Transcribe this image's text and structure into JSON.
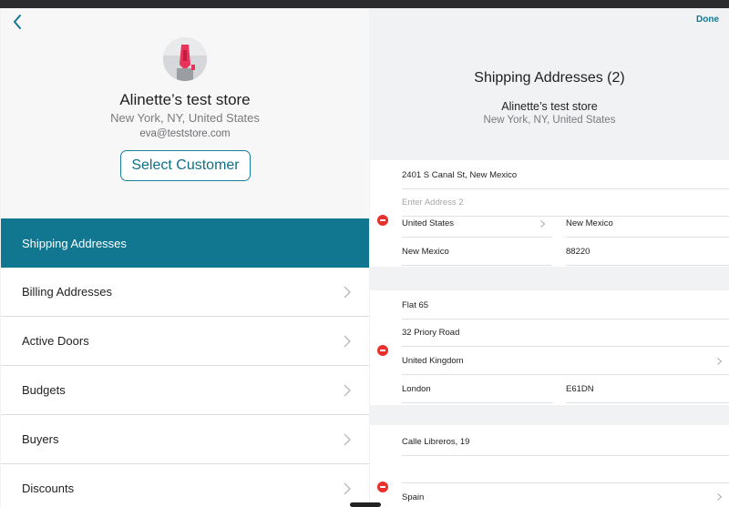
{
  "left": {
    "back_icon": "chevron-left-icon",
    "store_name": "Alinette’s test store",
    "store_location": "New York, NY, United States",
    "store_email": "eva@teststore.com",
    "select_customer_label": "Select Customer",
    "menu": [
      {
        "label": "Shipping Addresses",
        "active": true
      },
      {
        "label": "Billing Addresses",
        "active": false
      },
      {
        "label": "Active Doors",
        "active": false
      },
      {
        "label": "Budgets",
        "active": false
      },
      {
        "label": "Buyers",
        "active": false
      },
      {
        "label": "Discounts",
        "active": false
      }
    ]
  },
  "right": {
    "done_label": "Done",
    "title": "Shipping Addresses (2)",
    "store_name": "Alinette’s test store",
    "store_location": "New York, NY, United States",
    "addresses": [
      {
        "line1": "2401 S Canal St, New Mexico",
        "line2_placeholder": "Enter Address 2",
        "country": "United States",
        "state": "New Mexico",
        "city": "New Mexico",
        "zip": "88220"
      },
      {
        "line1": "Flat 65",
        "line2": "32 Priory Road",
        "country": "United Kingdom",
        "city": "London",
        "zip": "E61DN"
      },
      {
        "line1": "Calle Libreros, 19",
        "line2": "",
        "country": "Spain"
      }
    ]
  },
  "colors": {
    "accent": "#117690",
    "delete": "#e8312d",
    "background": "#f1f2f4"
  }
}
